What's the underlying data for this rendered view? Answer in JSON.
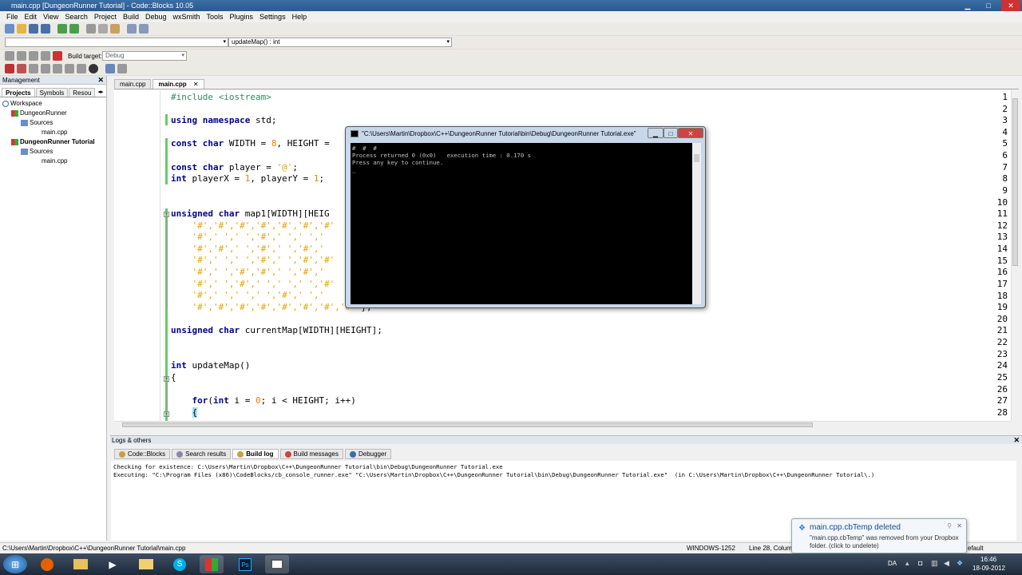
{
  "window": {
    "title": "main.cpp [DungeonRunner Tutorial] - Code::Blocks 10.05"
  },
  "menu": [
    "File",
    "Edit",
    "View",
    "Search",
    "Project",
    "Build",
    "Debug",
    "wxSmith",
    "Tools",
    "Plugins",
    "Settings",
    "Help"
  ],
  "toolbar": {
    "function_combo": "updateMap() : int",
    "build_target_label": "Build target:",
    "build_target_value": "Debug"
  },
  "management": {
    "title": "Management",
    "tabs": [
      "Projects",
      "Symbols",
      "Resou"
    ],
    "tree": {
      "workspace": "Workspace",
      "project1": "DungeonRunner",
      "sources1": "Sources",
      "file1": "main.cpp",
      "project2": "DungeonRunner Tutorial",
      "sources2": "Sources",
      "file2": "main.cpp"
    }
  },
  "editor": {
    "tabs": [
      "main.cpp",
      "main.cpp"
    ],
    "line_numbers": [
      "1",
      "2",
      "3",
      "4",
      "5",
      "6",
      "7",
      "8",
      "9",
      "10",
      "11",
      "12",
      "13",
      "14",
      "15",
      "16",
      "17",
      "18",
      "19",
      "20",
      "21",
      "22",
      "23",
      "24",
      "25",
      "26",
      "27",
      "28"
    ]
  },
  "console": {
    "title": "\"C:\\Users\\Martin\\Dropbox\\C++\\DungeonRunner Tutorial\\bin\\Debug\\DungeonRunner Tutorial.exe\"",
    "line1": "#  #  #",
    "line2": "Process returned 0 (0x0)   execution time : 0.170 s",
    "line3": "Press any key to continue.",
    "line4": "_"
  },
  "logs": {
    "title": "Logs & others",
    "tabs": [
      "Code::Blocks",
      "Search results",
      "Build log",
      "Build messages",
      "Debugger"
    ],
    "line1": "Checking for existence: C:\\Users\\Martin\\Dropbox\\C++\\DungeonRunner Tutorial\\bin\\Debug\\DungeonRunner Tutorial.exe",
    "line2": "Executing: \"C:\\Program Files (x86)\\CodeBlocks/cb_console_runner.exe\" \"C:\\Users\\Martin\\Dropbox\\C++\\DungeonRunner Tutorial\\bin\\Debug\\DungeonRunner Tutorial.exe\"  (in C:\\Users\\Martin\\Dropbox\\C++\\DungeonRunner Tutorial\\.)"
  },
  "status": {
    "path": "C:\\Users\\Martin\\Dropbox\\C++\\DungeonRunner Tutorial\\main.cpp",
    "encoding": "WINDOWS-1252",
    "position": "Line 28, Column",
    "mode": "efault"
  },
  "notification": {
    "title": "main.cpp.cbTemp deleted",
    "body": "\"main.cpp.cbTemp\" was removed from your Dropbox folder. (click to undelete)"
  },
  "tray": {
    "lang": "DA",
    "time": "16:46",
    "date": "18-09-2012"
  }
}
